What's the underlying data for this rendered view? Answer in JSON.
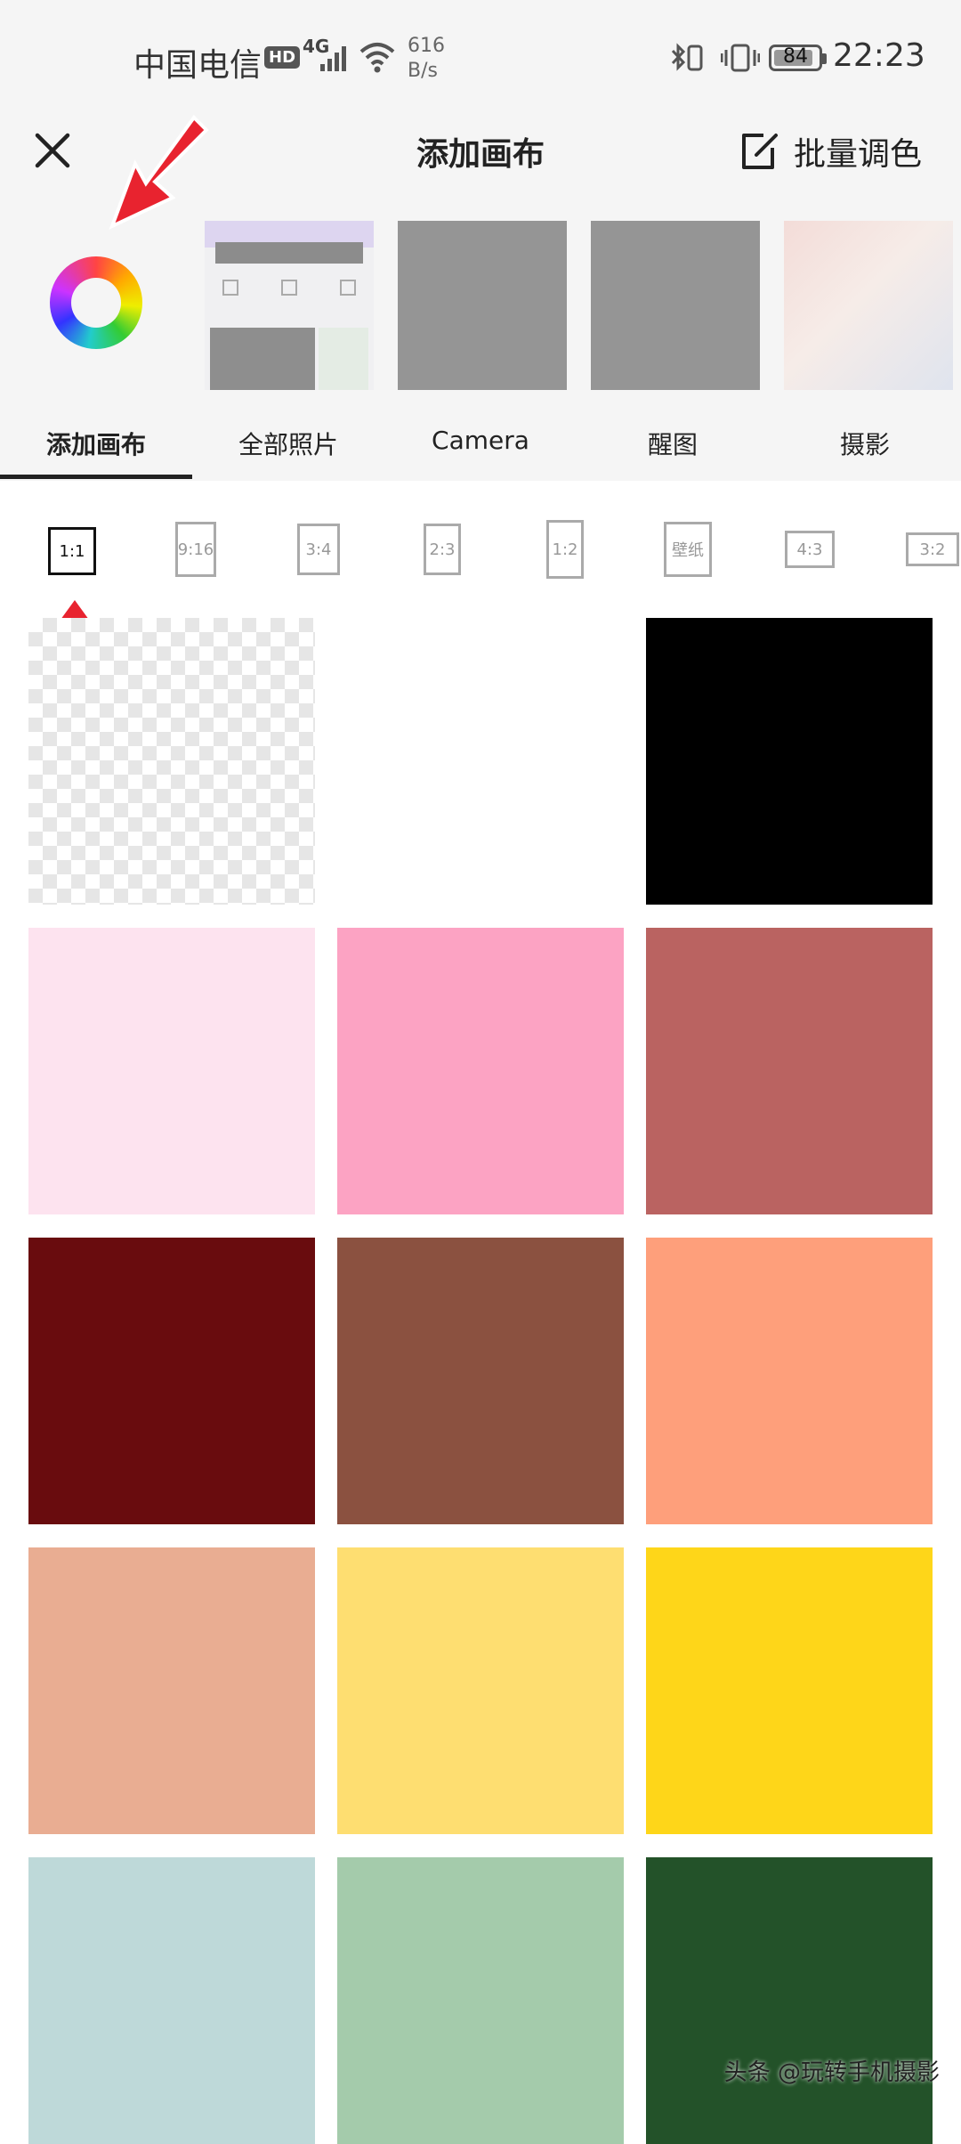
{
  "status_bar": {
    "carrier": "中国电信",
    "hd_badge": "HD",
    "network": "4G",
    "speed_value": "616",
    "speed_unit": "B/s",
    "battery": "84",
    "time": "22:23"
  },
  "header": {
    "title": "添加画布",
    "batch_label": "批量调色"
  },
  "tabs": [
    "添加画布",
    "全部照片",
    "Camera",
    "醒图",
    "摄影"
  ],
  "ratios": [
    "1:1",
    "9:16",
    "3:4",
    "2:3",
    "1:2",
    "壁纸",
    "4:3",
    "3:2"
  ],
  "selected_ratio": "1:1",
  "swatches": [
    "transparent",
    "#ffffff",
    "#000000",
    "#fde3ef",
    "#fca3c3",
    "#ba6361",
    "#690c0e",
    "#8b5140",
    "#fe9f7b",
    "#e9ad92",
    "#fede71",
    "#fed619",
    "#bed9d9",
    "#a4cbab",
    "#235229"
  ],
  "accent_arrow": "#e8232f",
  "watermark": "头条 @玩转手机摄影"
}
